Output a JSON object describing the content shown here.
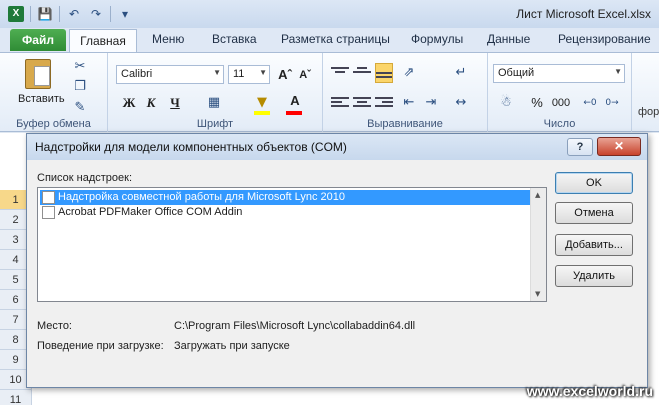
{
  "window": {
    "title": "Лист Microsoft Excel.xlsx",
    "app_icon": "excel-icon"
  },
  "quick_access": {
    "icons": [
      "save-icon",
      "undo-icon",
      "redo-icon",
      "customize-qat-icon"
    ]
  },
  "tabs": {
    "file": "Файл",
    "items": [
      "Главная",
      "Меню",
      "Вставка",
      "Разметка страницы",
      "Формулы",
      "Данные",
      "Рецензирование"
    ],
    "active": "Главная"
  },
  "ribbon": {
    "clipboard": {
      "paste_label": "Вставить",
      "group_label": "Буфер обмена"
    },
    "font": {
      "name": "Calibri",
      "size": "11",
      "bold": "Ж",
      "italic": "К",
      "underline": "Ч",
      "group_label": "Шрифт",
      "fill_color": "#ffff00",
      "font_color": "#ff0000"
    },
    "alignment": {
      "group_label": "Выравнивание"
    },
    "number": {
      "format": "Общий",
      "percent": "%",
      "thousands": "000",
      "group_label": "Число"
    },
    "styles": {
      "partial_label": "фор"
    }
  },
  "sheet": {
    "rows": [
      "1",
      "2",
      "3",
      "4",
      "5",
      "6",
      "7",
      "8",
      "9",
      "10",
      "11"
    ]
  },
  "dialog": {
    "title": "Надстройки для модели компонентных объектов (COM)",
    "help": "?",
    "close": "✕",
    "list_label": "Список надстроек:",
    "addins": [
      {
        "name": "Надстройка совместной работы для Microsoft Lync 2010",
        "checked": false,
        "selected": true
      },
      {
        "name": "Acrobat PDFMaker Office COM Addin",
        "checked": false,
        "selected": false
      }
    ],
    "buttons": {
      "ok": "OK",
      "cancel": "Отмена",
      "add": "Добавить...",
      "remove": "Удалить"
    },
    "location_label": "Место:",
    "location_value": "C:\\Program Files\\Microsoft Lync\\collabaddin64.dll",
    "behavior_label": "Поведение при загрузке:",
    "behavior_value": "Загружать при запуске"
  },
  "watermark": "www.excelworld.ru"
}
